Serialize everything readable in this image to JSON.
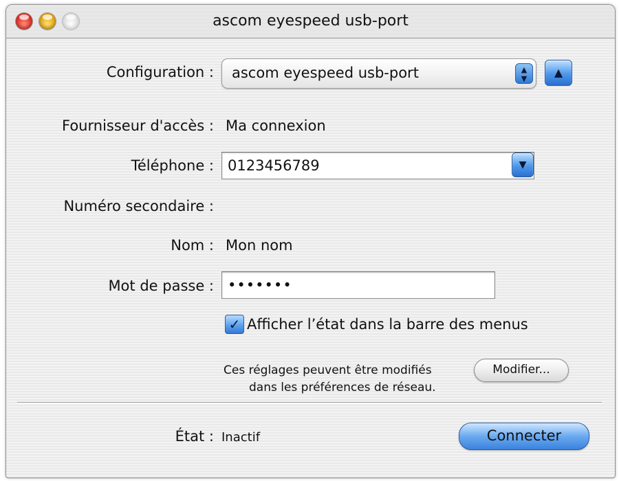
{
  "window": {
    "title": "ascom eyespeed usb-port"
  },
  "form": {
    "configuration_label": "Configuration :",
    "configuration_value": "ascom eyespeed usb-port",
    "provider_label": "Fournisseur d'accès :",
    "provider_value": "Ma connexion",
    "phone_label": "Téléphone :",
    "phone_value": "0123456789",
    "secondary_label": "Numéro secondaire :",
    "name_label": "Nom :",
    "name_value": "Mon nom",
    "password_label": "Mot de passe :",
    "password_value": "•••••••",
    "show_status_label": "Afficher l’état dans la barre des menus",
    "show_status_checked": true
  },
  "note": {
    "line1": "Ces réglages peuvent être modifiés",
    "line2": "dans les préférences de réseau.",
    "modify_button": "Modifier..."
  },
  "status": {
    "label": "État :",
    "value": "Inactif",
    "connect_button": "Connecter"
  },
  "colors": {
    "aqua_blue": "#3a83dd",
    "close_red": "#d8231a",
    "minimize_yellow": "#e09c07"
  }
}
